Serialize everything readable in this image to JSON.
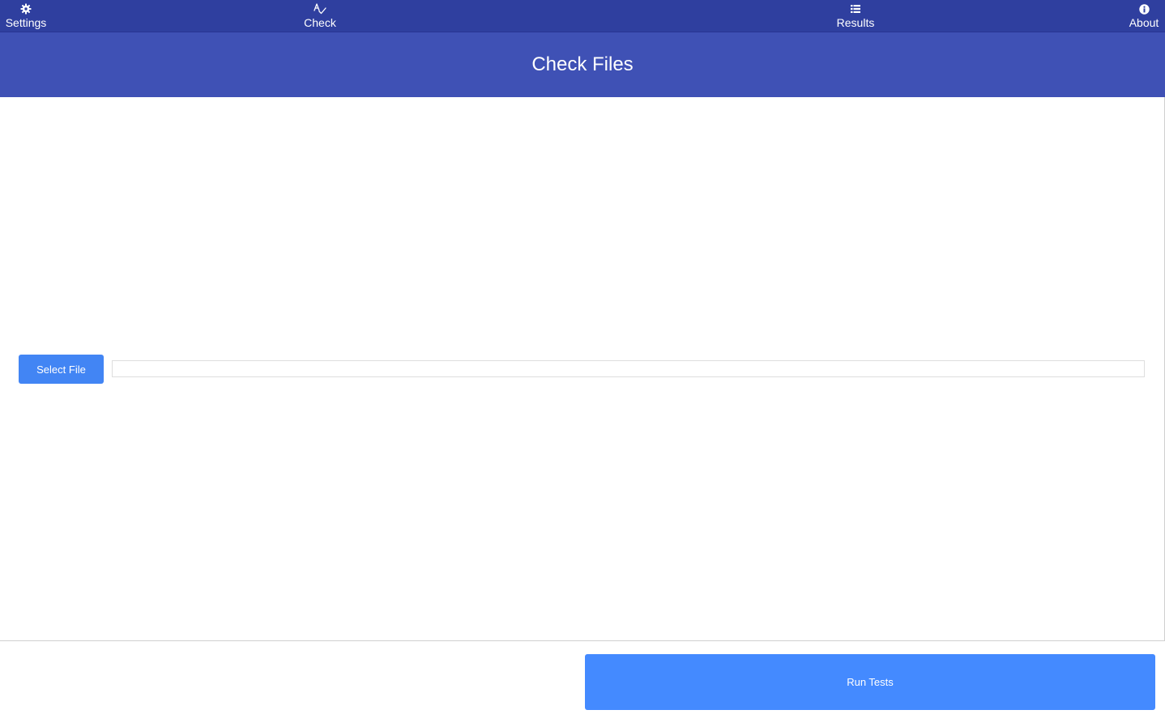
{
  "nav": {
    "items": [
      {
        "label": "Settings",
        "icon": "gear-icon"
      },
      {
        "label": "Check",
        "icon": "spellcheck-icon"
      },
      {
        "label": "Results",
        "icon": "list-icon"
      },
      {
        "label": "About",
        "icon": "info-icon"
      }
    ]
  },
  "header": {
    "title": "Check Files"
  },
  "main": {
    "select_file_label": "Select File",
    "file_path_value": "",
    "file_path_placeholder": ""
  },
  "footer": {
    "run_tests_label": "Run Tests"
  },
  "colors": {
    "nav_background": "#2f3f9f",
    "header_background": "#3f51b5",
    "button_primary": "#4285f4",
    "run_tests_button": "#448aff"
  }
}
